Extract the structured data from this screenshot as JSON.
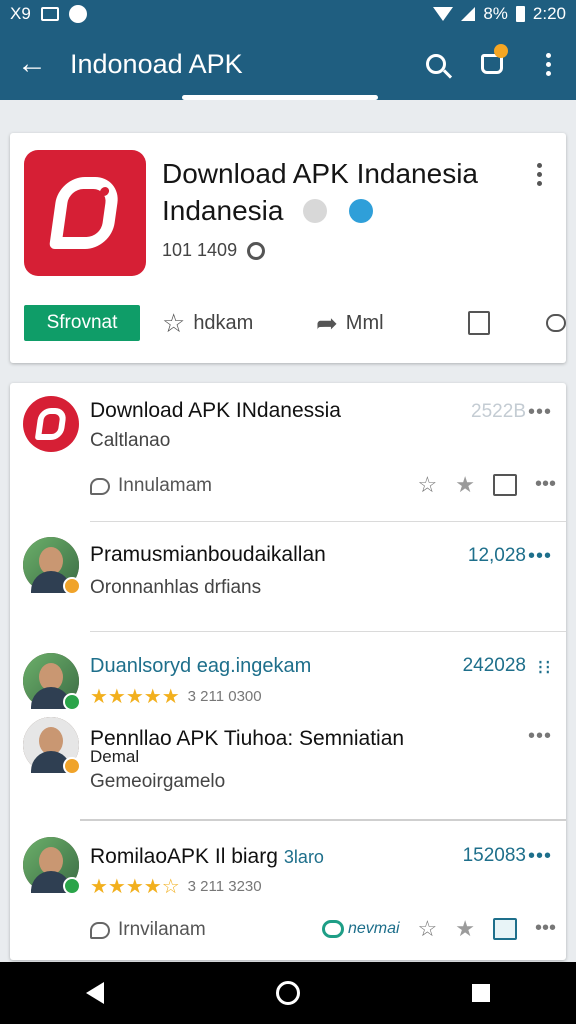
{
  "status_bar": {
    "left_text": "X9",
    "right_text": "8%",
    "time": "2:20"
  },
  "app_bar": {
    "title": "Indonoad APK",
    "back_icon": "arrow-left-icon",
    "search_icon": "search-icon",
    "cart_icon": "cart-icon",
    "cart_badge_color": "#f5a623",
    "menu_icon": "more-vert-icon",
    "color": "#1f5e80"
  },
  "app_card": {
    "title_line1": "Download APK Indanesia",
    "title_line2": "Indanesia",
    "meta": "101 1409",
    "install_label": "Sfrovnat",
    "action_wishlist": "hdkam",
    "action_share": "Mml",
    "accent_color": "#0f9d68",
    "icon_color": "#d61f35"
  },
  "list": {
    "rows": [
      {
        "title": "Download APK INdanessia",
        "subtitle": "Caltlanao",
        "right_value": "2522B",
        "footer_link": "Innulamam",
        "more": "•••"
      },
      {
        "title": "Pramusmianboudaikallan",
        "subtitle": "Oronnanhlas drfians",
        "right_value": "12,028",
        "more": "•••"
      },
      {
        "title": "Duanlsoryd eag.ingekam",
        "rating_count": "3 211 0300",
        "stars": "★★★★★",
        "right_value": "242028",
        "more": "⁝⁝"
      },
      {
        "title": "Pennllao APK Tiuhoa: Semniatian",
        "title_extra": "Demal",
        "subtitle": "Gemeoirgamelo",
        "more": "•••"
      },
      {
        "title": "RomilaoAPK Il biarg",
        "title_suffix": "3laro",
        "rating_count": "3 211 3230",
        "stars": "★★★★☆",
        "right_value": "152083",
        "footer_link": "Irnvilanam",
        "pill_label": "nevmai",
        "more": "•••"
      }
    ]
  },
  "nav_bar": {
    "back_icon": "nav-back-icon",
    "home_icon": "nav-home-icon",
    "recents_icon": "nav-recents-icon"
  }
}
